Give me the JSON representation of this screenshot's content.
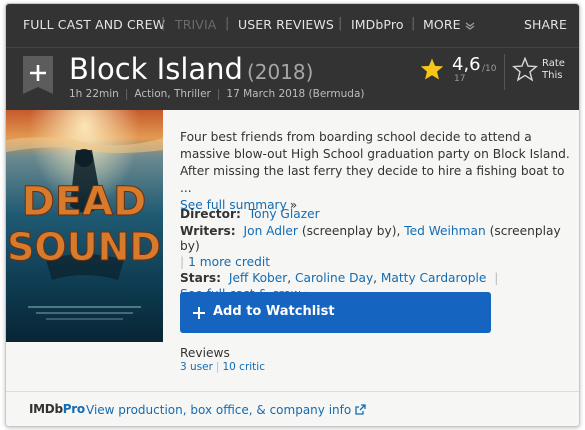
{
  "subnav": {
    "full_cast": "FULL CAST AND CREW",
    "trivia": "TRIVIA",
    "user_reviews": "USER REVIEWS",
    "imdbpro": "IMDbPro",
    "more": "MORE",
    "share": "SHARE",
    "separator": "|"
  },
  "title": {
    "name": "Block Island",
    "year": "(2018)",
    "runtime": "1h 22min",
    "genres": "Action, Thriller",
    "release": "17 March 2018 (Bermuda)",
    "meta_separator": "|"
  },
  "rating": {
    "value": "4,6",
    "max": "/10",
    "count": "17",
    "rate_label": "Rate This"
  },
  "poster": {
    "title_line1": "DEAD",
    "title_line2": "SOUND"
  },
  "plot": {
    "text": "Four best friends from boarding school decide to attend a massive blow-out High School graduation party on Block Island. After missing the last ferry they decide to hire a fishing boat to ...",
    "see_summary": "See full summary",
    "chevron": "»"
  },
  "credits": {
    "director_label": "Director:",
    "director": "Tony Glazer",
    "writers_label": "Writers:",
    "writer1": "Jon Adler",
    "writer1_note": "(screenplay by),",
    "writer2": "Ted Weihman",
    "writer2_note": "(screenplay by)",
    "more_credit": "1 more credit",
    "stars_label": "Stars:",
    "star1": "Jeff Kober",
    "star2": "Caroline Day",
    "star3": "Matty Cardarople",
    "see_cast": "See full cast & crew",
    "comma": ",",
    "pipe": "|",
    "chevron": "»"
  },
  "watchlist": {
    "label": "Add to Watchlist"
  },
  "reviews": {
    "heading": "Reviews",
    "user": "3 user",
    "critic": "10 critic",
    "pipe": "|"
  },
  "footer": {
    "logo_imdb": "IMDb",
    "logo_pro": "Pro",
    "link": "View production, box office, & company info"
  },
  "colors": {
    "header_bg": "#333333",
    "link": "#136cb2",
    "button": "#1464c0",
    "star": "#f5c518"
  },
  "icons": {
    "plus_tab": "watchlist-ribbon-plus-icon",
    "star": "star-filled-icon",
    "rate": "star-outline-icon",
    "more": "chevron-down-icon",
    "external": "external-link-icon"
  }
}
